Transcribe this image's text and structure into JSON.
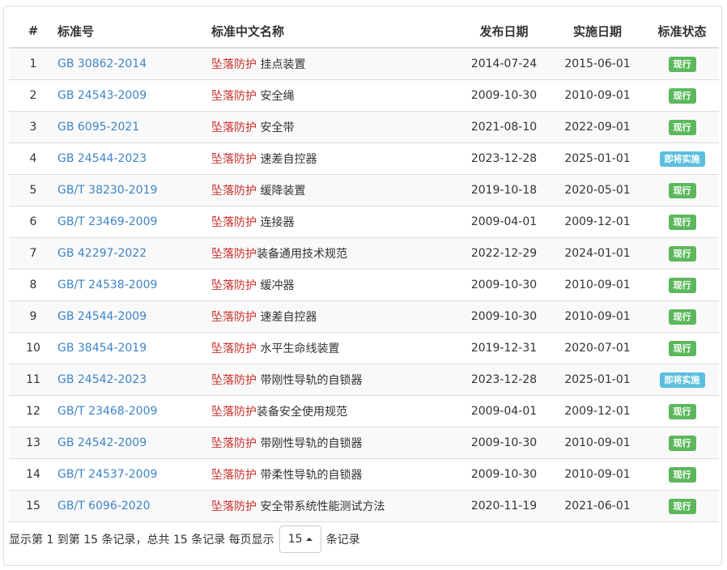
{
  "table": {
    "headers": {
      "index": "#",
      "number": "标准号",
      "name": "标准中文名称",
      "publish": "发布日期",
      "implement": "实施日期",
      "status": "标准状态"
    },
    "keyword": "坠落防护",
    "rows": [
      {
        "index": "1",
        "number": "GB 30862-2014",
        "name": " 挂点装置",
        "publish": "2014-07-24",
        "implement": "2015-06-01",
        "status": "现行",
        "status_type": "current"
      },
      {
        "index": "2",
        "number": "GB 24543-2009",
        "name": " 安全绳",
        "publish": "2009-10-30",
        "implement": "2010-09-01",
        "status": "现行",
        "status_type": "current"
      },
      {
        "index": "3",
        "number": "GB 6095-2021",
        "name": " 安全带",
        "publish": "2021-08-10",
        "implement": "2022-09-01",
        "status": "现行",
        "status_type": "current"
      },
      {
        "index": "4",
        "number": "GB 24544-2023",
        "name": " 速差自控器",
        "publish": "2023-12-28",
        "implement": "2025-01-01",
        "status": "即将实施",
        "status_type": "soon"
      },
      {
        "index": "5",
        "number": "GB/T 38230-2019",
        "name": " 缓降装置",
        "publish": "2019-10-18",
        "implement": "2020-05-01",
        "status": "现行",
        "status_type": "current"
      },
      {
        "index": "6",
        "number": "GB/T 23469-2009",
        "name": " 连接器",
        "publish": "2009-04-01",
        "implement": "2009-12-01",
        "status": "现行",
        "status_type": "current"
      },
      {
        "index": "7",
        "number": "GB 42297-2022",
        "name": "装备通用技术规范",
        "publish": "2022-12-29",
        "implement": "2024-01-01",
        "status": "现行",
        "status_type": "current"
      },
      {
        "index": "8",
        "number": "GB/T 24538-2009",
        "name": " 缓冲器",
        "publish": "2009-10-30",
        "implement": "2010-09-01",
        "status": "现行",
        "status_type": "current"
      },
      {
        "index": "9",
        "number": "GB 24544-2009",
        "name": " 速差自控器",
        "publish": "2009-10-30",
        "implement": "2010-09-01",
        "status": "现行",
        "status_type": "current"
      },
      {
        "index": "10",
        "number": "GB 38454-2019",
        "name": " 水平生命线装置",
        "publish": "2019-12-31",
        "implement": "2020-07-01",
        "status": "现行",
        "status_type": "current"
      },
      {
        "index": "11",
        "number": "GB 24542-2023",
        "name": " 带刚性导轨的自锁器",
        "publish": "2023-12-28",
        "implement": "2025-01-01",
        "status": "即将实施",
        "status_type": "soon"
      },
      {
        "index": "12",
        "number": "GB/T 23468-2009",
        "name": "装备安全使用规范",
        "publish": "2009-04-01",
        "implement": "2009-12-01",
        "status": "现行",
        "status_type": "current"
      },
      {
        "index": "13",
        "number": "GB 24542-2009",
        "name": " 带刚性导轨的自锁器",
        "publish": "2009-10-30",
        "implement": "2010-09-01",
        "status": "现行",
        "status_type": "current"
      },
      {
        "index": "14",
        "number": "GB/T 24537-2009",
        "name": " 带柔性导轨的自锁器",
        "publish": "2009-10-30",
        "implement": "2010-09-01",
        "status": "现行",
        "status_type": "current"
      },
      {
        "index": "15",
        "number": "GB/T 6096-2020",
        "name": " 安全带系统性能测试方法",
        "publish": "2020-11-19",
        "implement": "2021-06-01",
        "status": "现行",
        "status_type": "current"
      }
    ]
  },
  "pagination": {
    "summary": "显示第 1 到第 15 条记录，总共 15 条记录 每页显示",
    "page_size": "15",
    "suffix": "条记录"
  }
}
